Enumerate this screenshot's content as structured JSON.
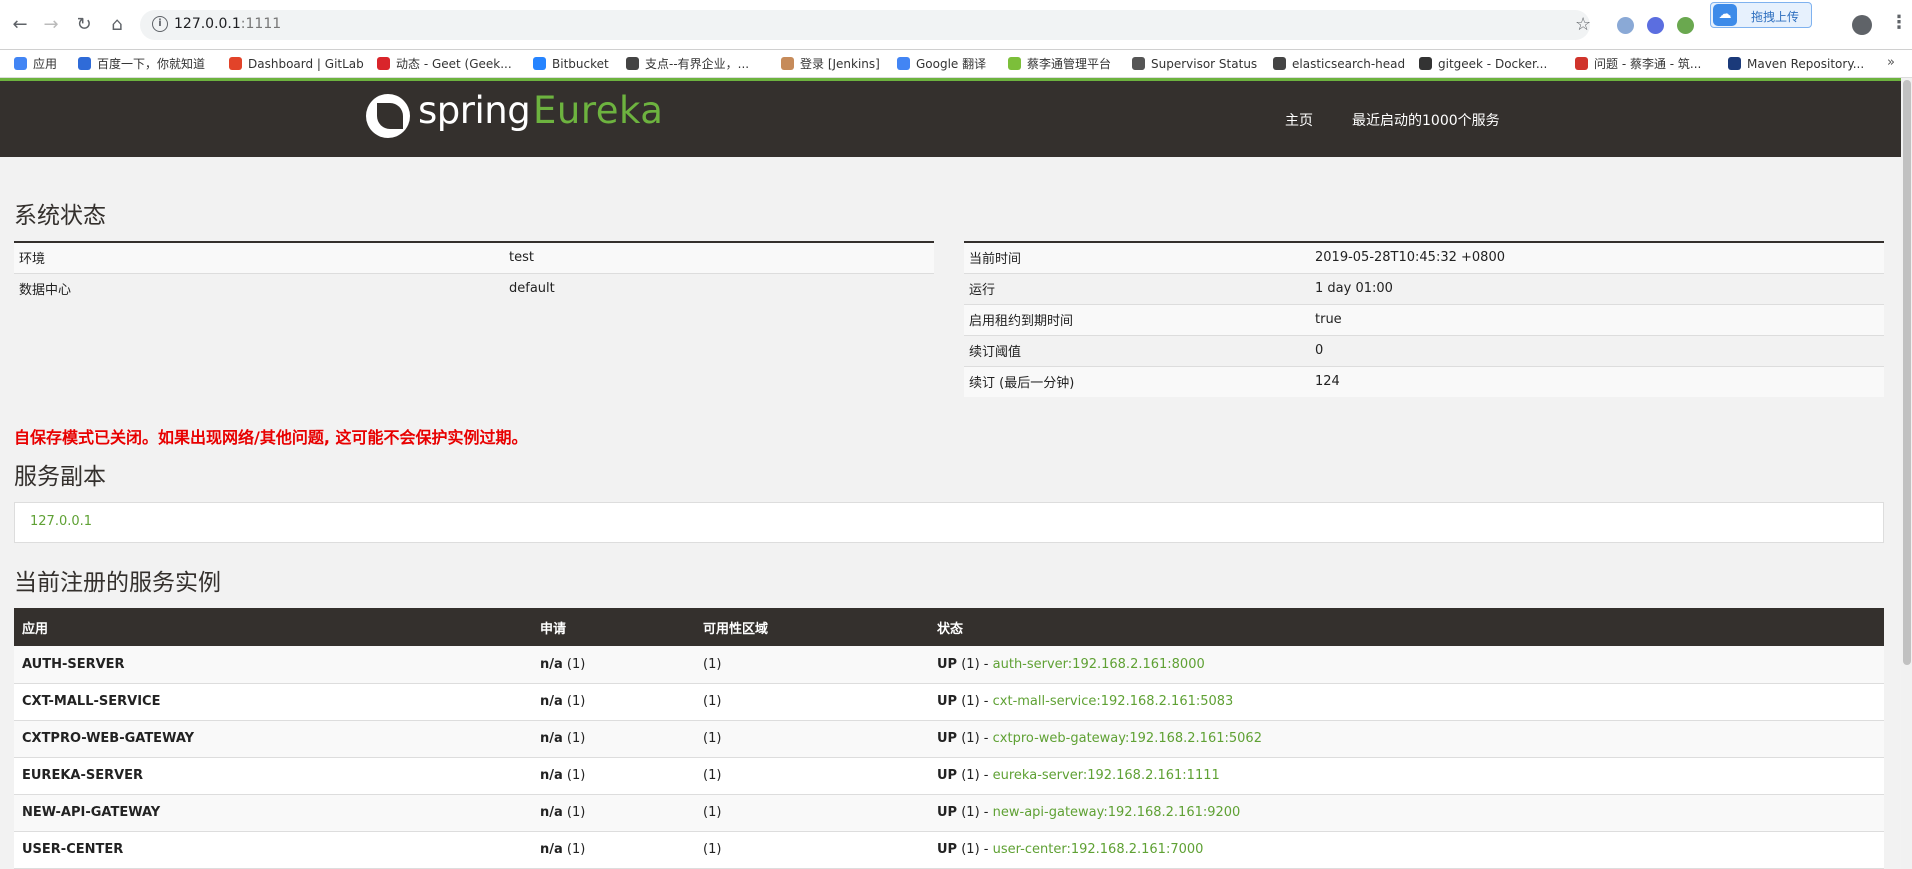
{
  "browser": {
    "url_host": "127.0.0.1",
    "url_port": ":1111",
    "upload_badge": "拖拽上传"
  },
  "bookmarks": [
    {
      "label": "应用",
      "color": "#4285f4"
    },
    {
      "label": "百度一下，你就知道",
      "color": "#2f6bd8"
    },
    {
      "label": "Dashboard | GitLab",
      "color": "#e24329"
    },
    {
      "label": "动态 - Geet (Geek...",
      "color": "#d9252b"
    },
    {
      "label": "Bitbucket",
      "color": "#2684ff"
    },
    {
      "label": "支点--有界企业，...",
      "color": "#444444"
    },
    {
      "label": "登录 [Jenkins]",
      "color": "#c68b5a"
    },
    {
      "label": "Google 翻译",
      "color": "#4285f4"
    },
    {
      "label": "蔡李通管理平台",
      "color": "#7cbf3a"
    },
    {
      "label": "Supervisor Status",
      "color": "#555555"
    },
    {
      "label": "elasticsearch-head",
      "color": "#444444"
    },
    {
      "label": "gitgeek - Docker...",
      "color": "#333333"
    },
    {
      "label": "问题 - 蔡李通 - 筑...",
      "color": "#d0342c"
    },
    {
      "label": "Maven Repository...",
      "color": "#1b3a7a"
    }
  ],
  "header": {
    "logo_spring": "spring",
    "logo_eureka": "Eureka",
    "nav_home": "主页",
    "nav_recent": "最近启动的1000个服务"
  },
  "system_status": {
    "title": "系统状态",
    "left": [
      {
        "key": "环境",
        "value": "test"
      },
      {
        "key": "数据中心",
        "value": "default"
      }
    ],
    "right": [
      {
        "key": "当前时间",
        "value": "2019-05-28T10:45:32 +0800"
      },
      {
        "key": "运行",
        "value": "1 day 01:00"
      },
      {
        "key": "启用租约到期时间",
        "value": "true"
      },
      {
        "key": "续订阈值",
        "value": "0"
      },
      {
        "key": "续订 (最后一分钟)",
        "value": "124"
      }
    ]
  },
  "warning": "自保存模式已关闭。如果出现网络/其他问题, 这可能不会保护实例过期。",
  "replicas": {
    "title": "服务副本",
    "items": [
      "127.0.0.1"
    ]
  },
  "instances": {
    "title": "当前注册的服务实例",
    "headers": [
      "应用",
      "申请",
      "可用性区域",
      "状态"
    ],
    "rows": [
      {
        "app": "AUTH-SERVER",
        "ami": "n/a",
        "ami_count": "(1)",
        "zones": "(1)",
        "status": "UP",
        "status_count": "(1)",
        "sep": "-",
        "link": "auth-server:192.168.2.161:8000"
      },
      {
        "app": "CXT-MALL-SERVICE",
        "ami": "n/a",
        "ami_count": "(1)",
        "zones": "(1)",
        "status": "UP",
        "status_count": "(1)",
        "sep": "-",
        "link": "cxt-mall-service:192.168.2.161:5083"
      },
      {
        "app": "CXTPRO-WEB-GATEWAY",
        "ami": "n/a",
        "ami_count": "(1)",
        "zones": "(1)",
        "status": "UP",
        "status_count": "(1)",
        "sep": "-",
        "link": "cxtpro-web-gateway:192.168.2.161:5062"
      },
      {
        "app": "EUREKA-SERVER",
        "ami": "n/a",
        "ami_count": "(1)",
        "zones": "(1)",
        "status": "UP",
        "status_count": "(1)",
        "sep": "-",
        "link": "eureka-server:192.168.2.161:1111"
      },
      {
        "app": "NEW-API-GATEWAY",
        "ami": "n/a",
        "ami_count": "(1)",
        "zones": "(1)",
        "status": "UP",
        "status_count": "(1)",
        "sep": "-",
        "link": "new-api-gateway:192.168.2.161:9200"
      },
      {
        "app": "USER-CENTER",
        "ami": "n/a",
        "ami_count": "(1)",
        "zones": "(1)",
        "status": "UP",
        "status_count": "(1)",
        "sep": "-",
        "link": "user-center:192.168.2.161:7000"
      }
    ]
  },
  "colors": {
    "spring_green": "#6db33f",
    "header_dark": "#34302d",
    "warning_red": "#e80000",
    "link_green": "#5fa134"
  }
}
